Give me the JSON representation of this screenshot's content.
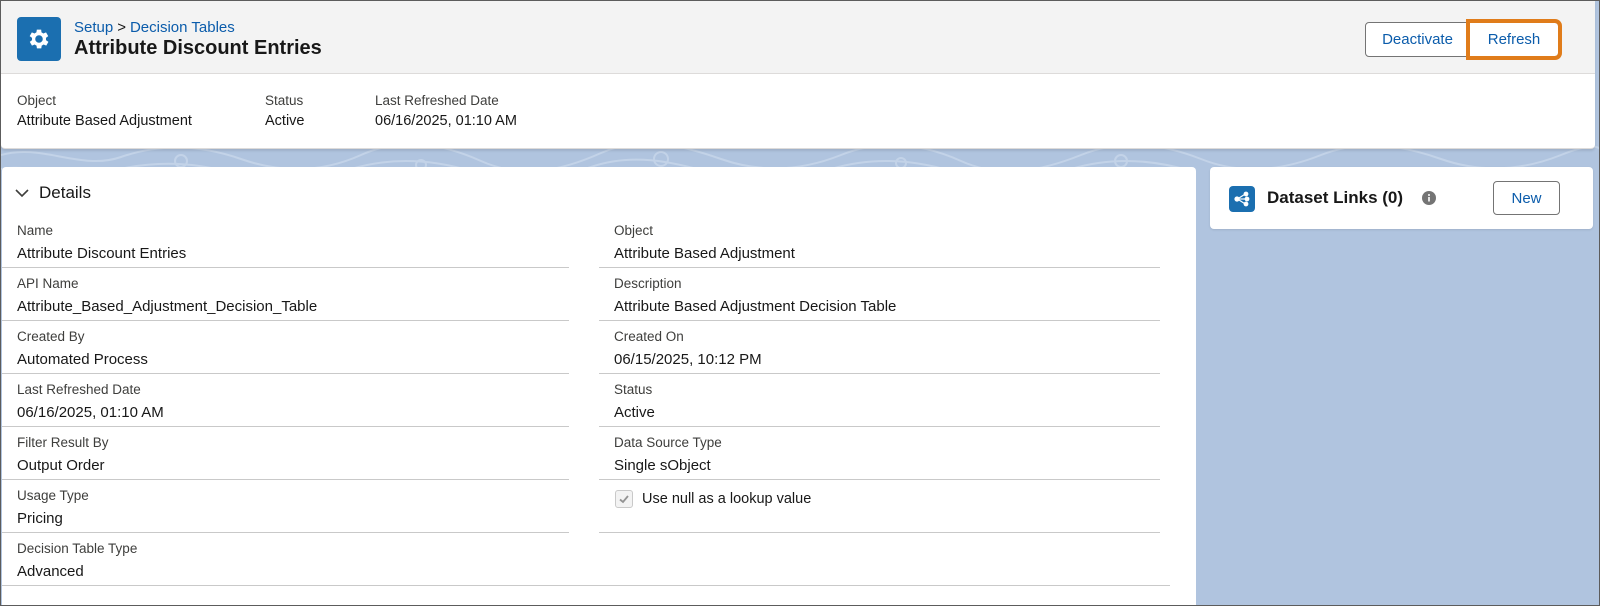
{
  "header": {
    "breadcrumb": {
      "root": "Setup",
      "separator": ">",
      "current": "Decision Tables"
    },
    "title": "Attribute Discount Entries",
    "actions": {
      "deactivate": "Deactivate",
      "refresh": "Refresh"
    },
    "icon": "gear-icon",
    "highlights": {
      "object_label": "Object",
      "object_value": "Attribute Based Adjustment",
      "status_label": "Status",
      "status_value": "Active",
      "refreshed_label": "Last Refreshed Date",
      "refreshed_value": "06/16/2025, 01:10 AM"
    }
  },
  "details": {
    "section_title": "Details",
    "left": [
      {
        "label": "Name",
        "value": "Attribute Discount Entries"
      },
      {
        "label": "API Name",
        "value": "Attribute_Based_Adjustment_Decision_Table"
      },
      {
        "label": "Created By",
        "value": "Automated Process"
      },
      {
        "label": "Last Refreshed Date",
        "value": "06/16/2025, 01:10 AM"
      },
      {
        "label": "Filter Result By",
        "value": "Output Order"
      },
      {
        "label": "Usage Type",
        "value": "Pricing"
      },
      {
        "label": "Decision Table Type",
        "value": "Advanced"
      }
    ],
    "right": [
      {
        "label": "Object",
        "value": "Attribute Based Adjustment"
      },
      {
        "label": "Description",
        "value": "Attribute Based Adjustment Decision Table"
      },
      {
        "label": "Created On",
        "value": "06/15/2025, 10:12 PM"
      },
      {
        "label": "Status",
        "value": "Active"
      },
      {
        "label": "Data Source Type",
        "value": "Single sObject"
      }
    ],
    "checkbox": {
      "label": "Use null as a lookup value",
      "checked": true
    }
  },
  "dataset_links": {
    "title": "Dataset Links (0)",
    "new_button": "New",
    "icon": "dataset-links-icon"
  },
  "colors": {
    "brand_blue": "#1b6fb0",
    "link_blue": "#0b5cab",
    "highlight_orange": "#e07c1a",
    "page_background": "#b0c4df"
  }
}
